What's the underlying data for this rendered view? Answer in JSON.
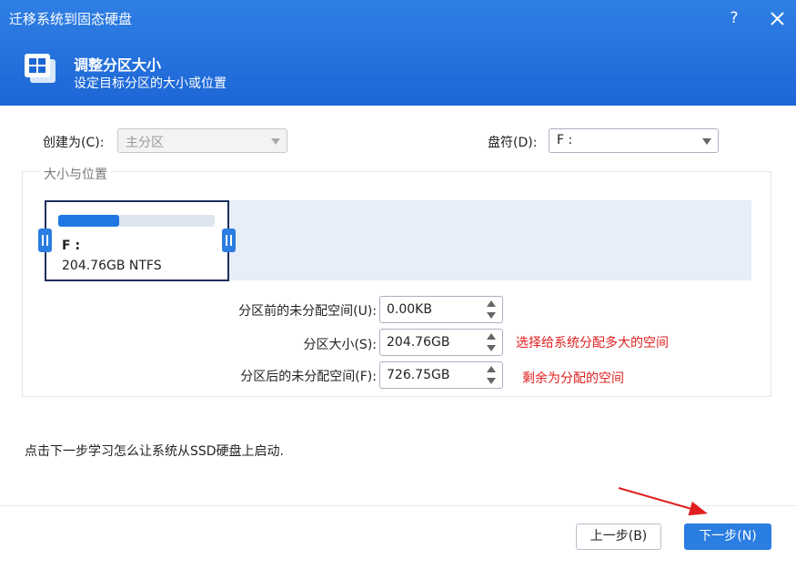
{
  "window": {
    "title": "迁移系统到固态硬盘",
    "help": "?",
    "close": "✕"
  },
  "header": {
    "title": "调整分区大小",
    "subtitle": "设定目标分区的大小或位置"
  },
  "create_as": {
    "label": "创建为(C):",
    "value": "主分区",
    "disabled": true
  },
  "drive_letter": {
    "label": "盘符(D):",
    "value": "F :"
  },
  "size_position": {
    "group_title": "大小与位置",
    "partition": {
      "letter": "F :",
      "info": "204.76GB NTFS",
      "usage_fraction": 0.39
    }
  },
  "fields": [
    {
      "label": "分区前的未分配空间(U):",
      "value": "0.00KB"
    },
    {
      "label": "分区大小(S):",
      "value": "204.76GB",
      "note": "选择给系统分配多大的空间"
    },
    {
      "label": "分区后的未分配空间(F):",
      "value": "726.75GB",
      "note": "剩余为分配的空间"
    }
  ],
  "hint": "点击下一步学习怎么让系统从SSD硬盘上启动.",
  "buttons": {
    "back": "上一步(B)",
    "next": "下一步(N)"
  },
  "colors": {
    "accent": "#2a7de1",
    "header": "#1d66d6",
    "note": "#e02020",
    "border_card": "#1c2f5c"
  }
}
